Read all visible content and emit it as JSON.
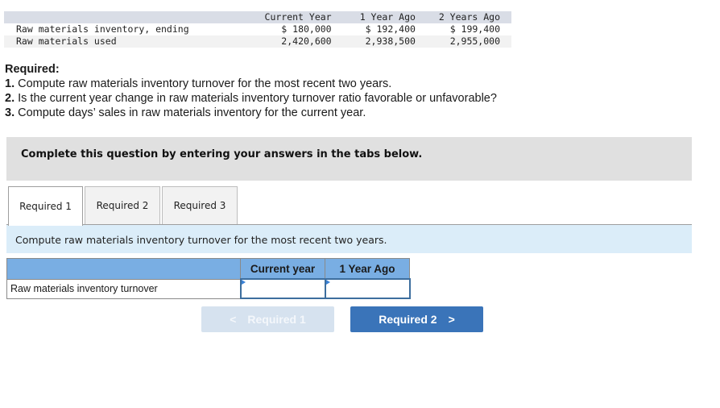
{
  "data_table": {
    "columns": [
      "",
      "Current Year",
      "1 Year Ago",
      "2 Years Ago"
    ],
    "rows": [
      {
        "label": "Raw materials inventory, ending",
        "values": [
          "$ 180,000",
          "$ 192,400",
          "$ 199,400"
        ]
      },
      {
        "label": "Raw materials used",
        "values": [
          "2,420,600",
          "2,938,500",
          "2,955,000"
        ]
      }
    ]
  },
  "required": {
    "heading": "Required:",
    "items": [
      {
        "num": "1.",
        "text": " Compute raw materials inventory turnover for the most recent two years."
      },
      {
        "num": "2.",
        "text": " Is the current year change in raw materials inventory turnover ratio favorable or unfavorable?"
      },
      {
        "num": "3.",
        "text": " Compute days’ sales in raw materials inventory for the current year."
      }
    ]
  },
  "instruction": "Complete this question by entering your answers in the tabs below.",
  "tabs": [
    {
      "label": "Required 1",
      "active": true
    },
    {
      "label": "Required 2",
      "active": false
    },
    {
      "label": "Required 3",
      "active": false
    }
  ],
  "prompt": "Compute raw materials inventory turnover for the most recent two years.",
  "answer_table": {
    "columns": [
      "",
      "Current year",
      "1 Year Ago"
    ],
    "rows": [
      {
        "label": "Raw materials inventory turnover",
        "values": [
          "",
          ""
        ]
      }
    ]
  },
  "nav": {
    "prev": {
      "label": "Required 1",
      "icon": "chevron-left-icon",
      "glyph": "<",
      "enabled": false
    },
    "next": {
      "label": "Required 2",
      "icon": "chevron-right-icon",
      "glyph": ">",
      "enabled": true
    }
  },
  "colors": {
    "accent_blue": "#3a74b9",
    "header_blue": "#79aee3",
    "prompt_bg": "#dbedf9",
    "instruction_bg": "#e0e0e0"
  }
}
